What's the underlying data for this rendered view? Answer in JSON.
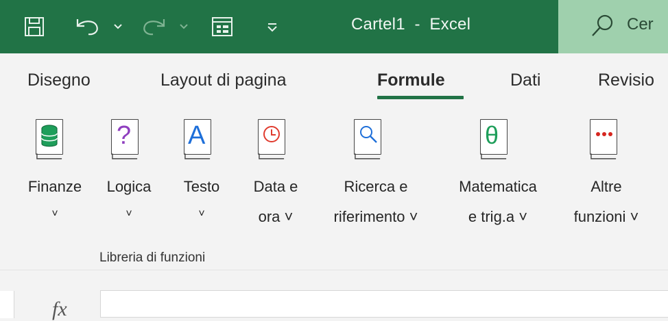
{
  "titlebar": {
    "doc_title": "Cartel1  -  Excel",
    "search_text": "Cer",
    "icons": [
      "save-icon",
      "undo-icon",
      "redo-icon",
      "form-icon",
      "customize-qat-icon",
      "search-icon"
    ]
  },
  "tabs": [
    {
      "label": "Disegno"
    },
    {
      "label": "Layout di pagina"
    },
    {
      "label": "Formule",
      "active": true
    },
    {
      "label": "Dati"
    },
    {
      "label": "Revisio"
    }
  ],
  "ribbon": {
    "group_label": "Libreria di funzioni",
    "buttons": [
      {
        "line1": "Finanze",
        "line2": "˅"
      },
      {
        "line1": "Logica",
        "line2": "˅"
      },
      {
        "line1": "Testo",
        "line2": "˅"
      },
      {
        "line1": "Data e",
        "line2": "ora ˅"
      },
      {
        "line1": "Ricerca e",
        "line2": "riferimento ˅"
      },
      {
        "line1": "Matematica",
        "line2": "e trig.a ˅"
      },
      {
        "line1": "Altre",
        "line2": "funzioni ˅"
      }
    ]
  },
  "formula_bar": {
    "fx_label": "fx",
    "value": ""
  },
  "colors": {
    "excel_green": "#217346",
    "search_bg": "#9fd0ad",
    "finance": "#1e9e5a",
    "logic": "#8f3fbf",
    "text": "#1e6fd9",
    "datetime": "#e03b2e",
    "lookup": "#1e6fd9",
    "math": "#1e9e5a",
    "more": "#d6261f"
  }
}
